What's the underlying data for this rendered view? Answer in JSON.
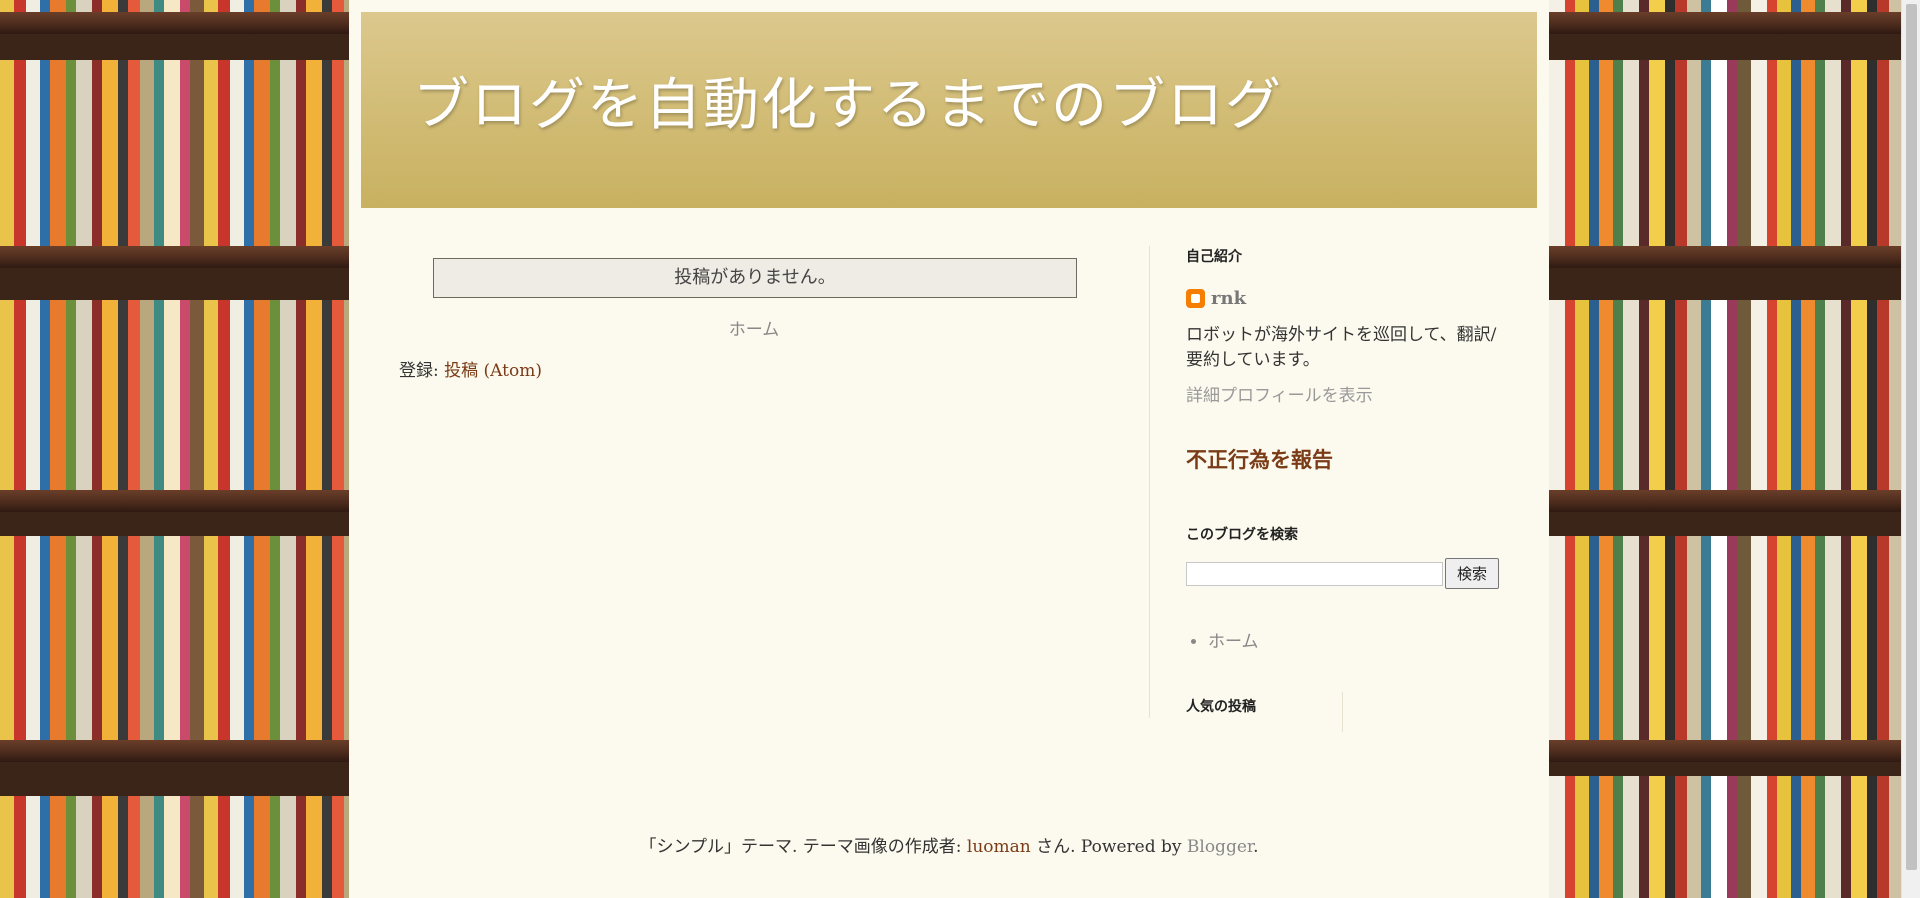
{
  "blog": {
    "title": "ブログを自動化するまでのブログ"
  },
  "main": {
    "no_posts": "投稿がありません。",
    "home_link": "ホーム",
    "feed_prefix": "登録: ",
    "feed_link": "投稿 (Atom)"
  },
  "sidebar": {
    "profile": {
      "title": "自己紹介",
      "name": "rnk",
      "description": "ロボットが海外サイトを巡回して、翻訳/要約しています。",
      "more": "詳細プロフィールを表示"
    },
    "report": "不正行為を報告",
    "search": {
      "title": "このブログを検索",
      "button": "検索",
      "value": ""
    },
    "pages": [
      {
        "label": "ホーム"
      }
    ],
    "popular": {
      "title": "人気の投稿"
    }
  },
  "footer": {
    "theme_text": "「シンプル」テーマ. テーマ画像の作成者: ",
    "author": "luoman",
    "suffix": " さん. Powered by ",
    "powered": "Blogger",
    "end": "."
  },
  "colors": {
    "accent_brown": "#7a3b17",
    "header_gold": "#c8b160",
    "page_bg": "#fcf9ee",
    "blogger_orange": "#f57d00"
  }
}
